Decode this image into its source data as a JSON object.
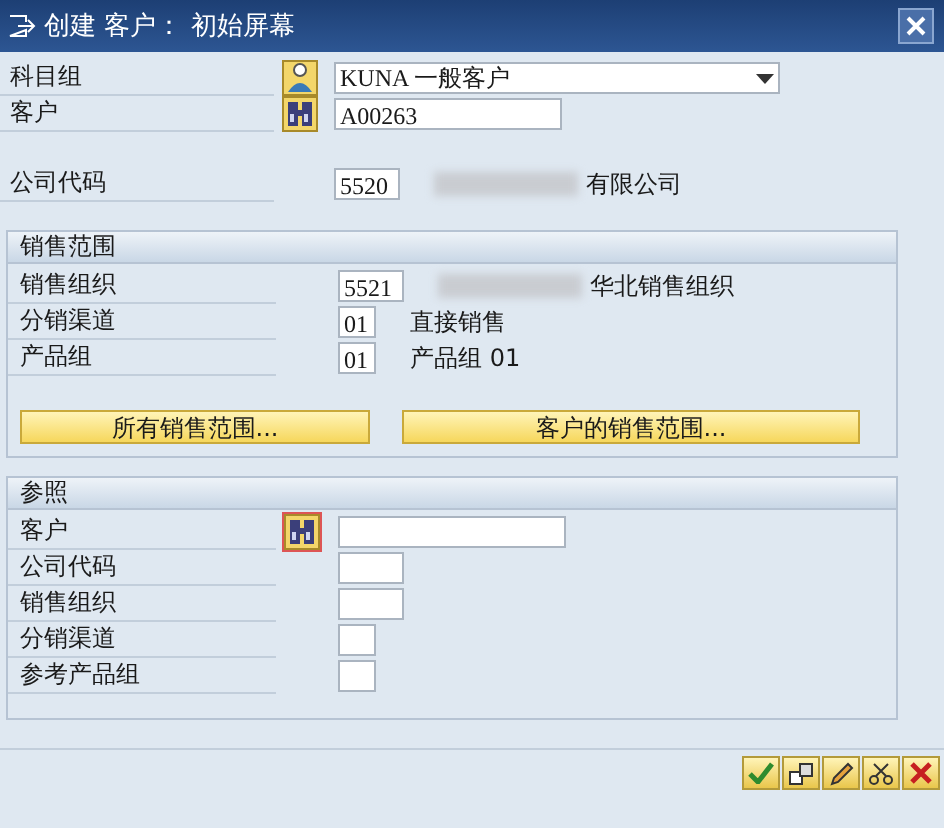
{
  "window": {
    "title": "创建 客户： 初始屏幕"
  },
  "header_fields": [
    {
      "label": "科目组",
      "kind": "dropdown",
      "value": "KUNA  一般客户"
    },
    {
      "label": "客户",
      "kind": "search",
      "value": "A00263"
    }
  ],
  "company_code": {
    "label": "公司代码",
    "value": "5520",
    "redacted": true,
    "description": "有限公司"
  },
  "sales_area": {
    "title": "销售范围",
    "fields": [
      {
        "label": "销售组织",
        "kind": "medium",
        "value": "5521",
        "redacted": true,
        "description": "华北销售组织"
      },
      {
        "label": "分销渠道",
        "kind": "short",
        "value": "01",
        "redacted": false,
        "description": "直接销售"
      },
      {
        "label": "产品组",
        "kind": "short",
        "value": "01",
        "redacted": false,
        "description": "产品组 01"
      }
    ],
    "buttons": [
      "所有销售范围...",
      "客户的销售范围..."
    ]
  },
  "reference": {
    "title": "参照",
    "fields": [
      {
        "label": "客户",
        "kind": "search"
      },
      {
        "label": "公司代码",
        "kind": "medium"
      },
      {
        "label": "销售组织",
        "kind": "medium"
      },
      {
        "label": "分销渠道",
        "kind": "short"
      },
      {
        "label": "参考产品组",
        "kind": "short"
      }
    ]
  }
}
